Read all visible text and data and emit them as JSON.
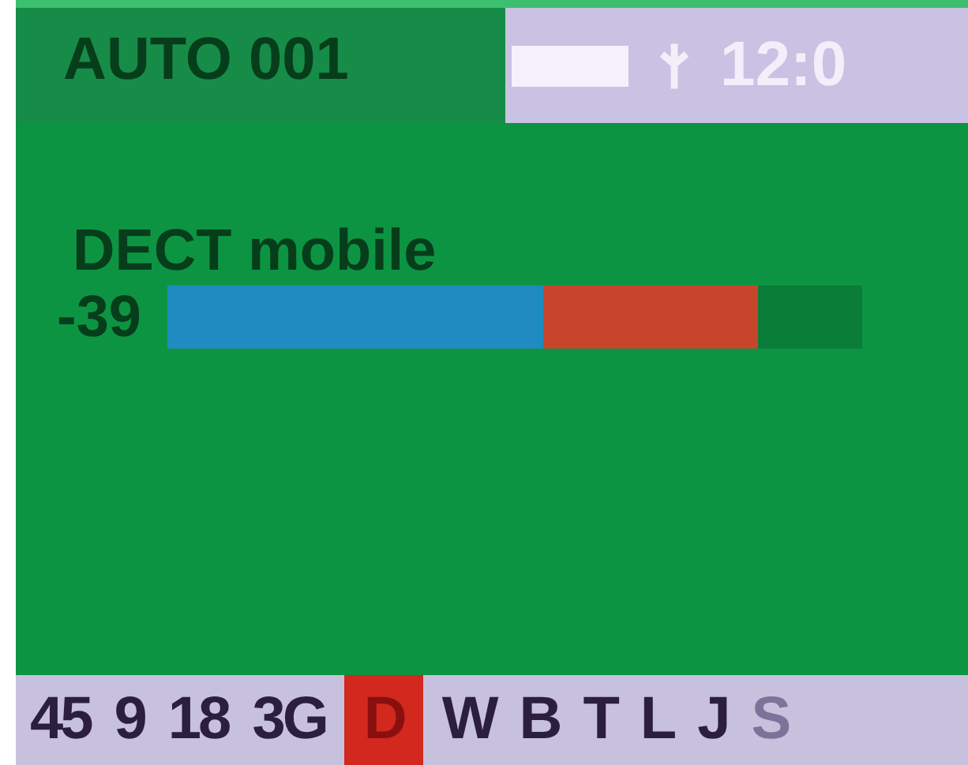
{
  "header": {
    "mode": "AUTO 001",
    "time": "12:0"
  },
  "signal": {
    "name": "DECT mobile",
    "reading": "-39",
    "level": 0.54,
    "peak": {
      "level": 0.85
    }
  },
  "bands": [
    {
      "label": "45",
      "selected": false,
      "disabled": false
    },
    {
      "label": "9",
      "selected": false,
      "disabled": false
    },
    {
      "label": "18",
      "selected": false,
      "disabled": false
    },
    {
      "label": "3G",
      "selected": false,
      "disabled": false
    },
    {
      "label": "D",
      "selected": true,
      "disabled": false
    },
    {
      "label": "W",
      "selected": false,
      "disabled": false
    },
    {
      "label": "B",
      "selected": false,
      "disabled": false
    },
    {
      "label": "T",
      "selected": false,
      "disabled": false
    },
    {
      "label": "L",
      "selected": false,
      "disabled": false
    },
    {
      "label": "J",
      "selected": false,
      "disabled": false
    },
    {
      "label": "S",
      "selected": false,
      "disabled": true
    }
  ]
}
